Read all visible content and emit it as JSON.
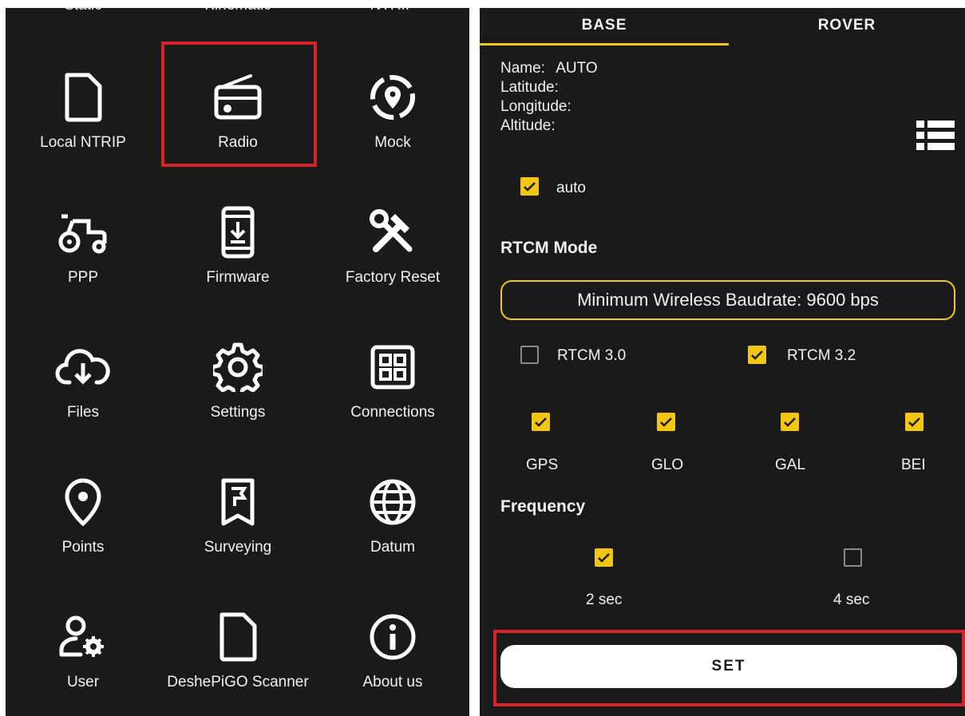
{
  "left_menu": {
    "top_cut_labels": [
      "Static",
      "Kinematic",
      "NTRIP"
    ],
    "items": [
      {
        "label": "Local NTRIP",
        "icon": "file-icon"
      },
      {
        "label": "Radio",
        "icon": "radio-icon"
      },
      {
        "label": "Mock",
        "icon": "location-pin-dashed-icon"
      },
      {
        "label": "PPP",
        "icon": "tractor-icon"
      },
      {
        "label": "Firmware",
        "icon": "phone-download-icon"
      },
      {
        "label": "Factory Reset",
        "icon": "tools-icon"
      },
      {
        "label": "Files",
        "icon": "cloud-download-icon"
      },
      {
        "label": "Settings",
        "icon": "gear-icon"
      },
      {
        "label": "Connections",
        "icon": "grid-icon"
      },
      {
        "label": "Points",
        "icon": "location-pin-icon"
      },
      {
        "label": "Surveying",
        "icon": "flag-bookmark-icon"
      },
      {
        "label": "Datum",
        "icon": "globe-icon"
      },
      {
        "label": "User",
        "icon": "user-settings-icon"
      },
      {
        "label": "DeshePiGO Scanner",
        "icon": "file-icon"
      },
      {
        "label": "About us",
        "icon": "info-icon"
      }
    ],
    "highlighted": "Radio"
  },
  "right_panel": {
    "tabs": [
      {
        "label": "BASE",
        "active": true
      },
      {
        "label": "ROVER",
        "active": false
      }
    ],
    "info": {
      "name_label": "Name:",
      "name_value": "AUTO",
      "latitude_label": "Latitude:",
      "longitude_label": "Longitude:",
      "altitude_label": "Altitude:"
    },
    "auto_checkbox": {
      "label": "auto",
      "checked": true
    },
    "rtcm_header": "RTCM Mode",
    "baudrate_button": "Minimum Wireless Baudrate:  9600 bps",
    "rtcm_versions": [
      {
        "label": "RTCM 3.0",
        "checked": false
      },
      {
        "label": "RTCM 3.2",
        "checked": true
      }
    ],
    "constellations": [
      {
        "label": "GPS",
        "checked": true
      },
      {
        "label": "GLO",
        "checked": true
      },
      {
        "label": "GAL",
        "checked": true
      },
      {
        "label": "BEI",
        "checked": true
      }
    ],
    "frequency_header": "Frequency",
    "frequencies": [
      {
        "label": "2 sec",
        "checked": true
      },
      {
        "label": "4 sec",
        "checked": false
      }
    ],
    "set_button": "SET"
  },
  "colors": {
    "accent": "#f3c614",
    "highlight": "#d9232a",
    "background": "#1a1a1a"
  }
}
